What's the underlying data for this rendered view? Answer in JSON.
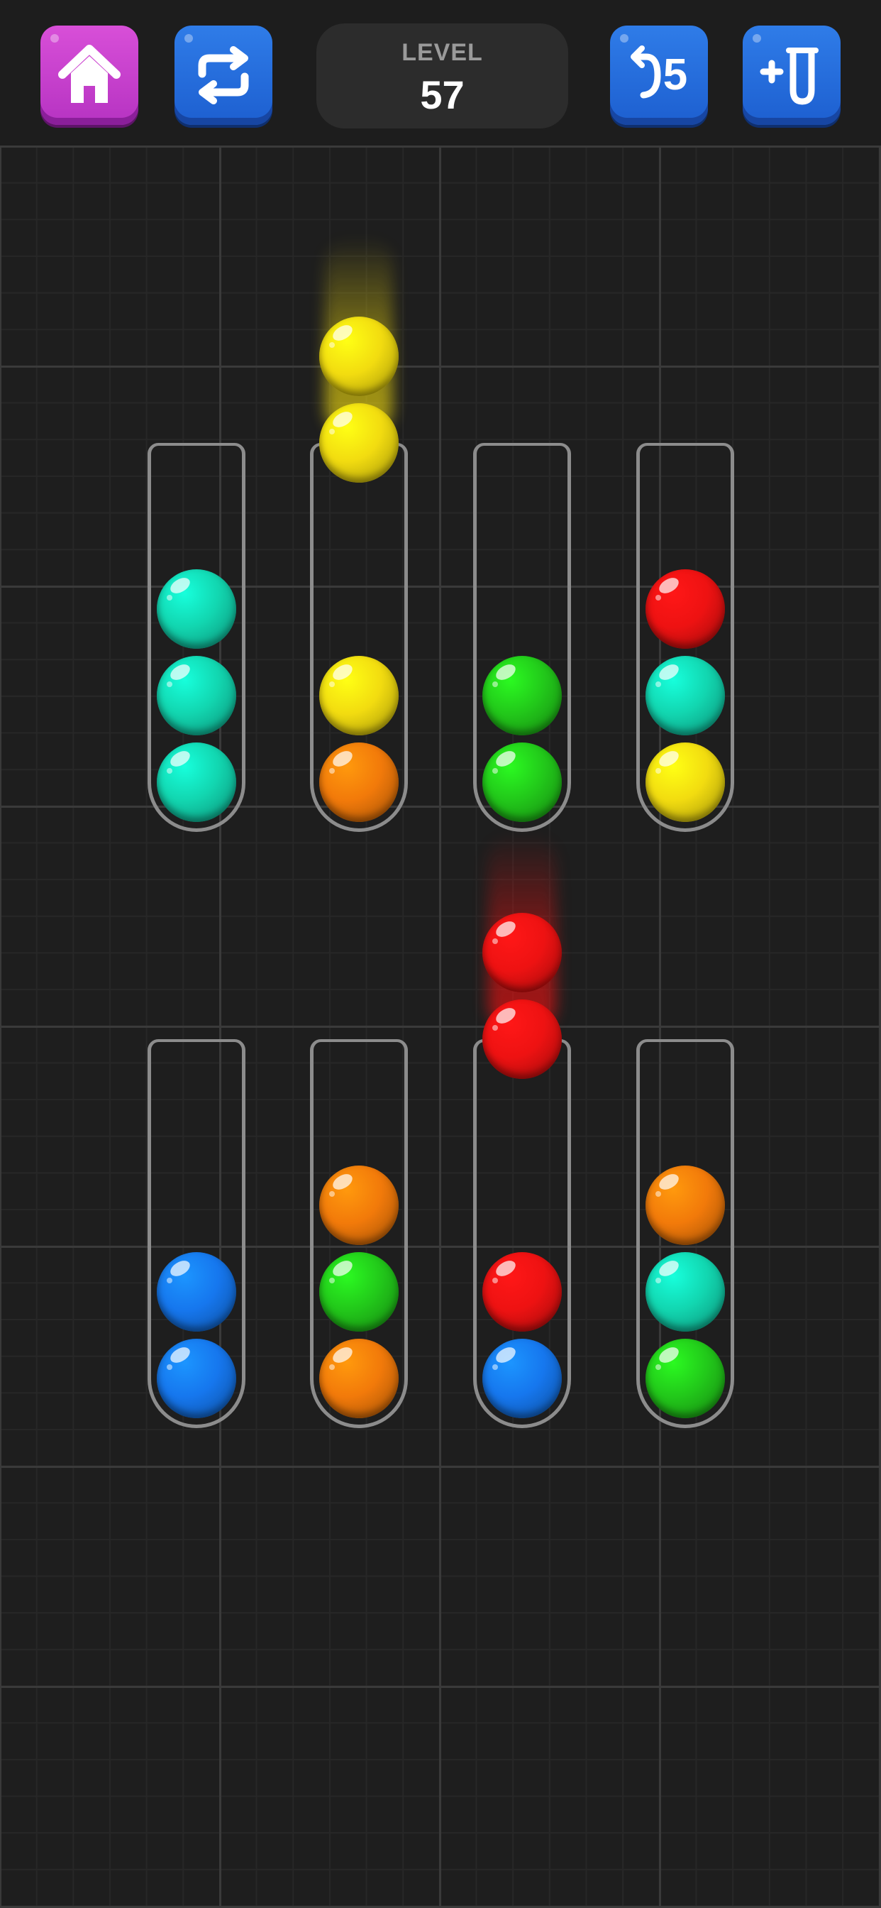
{
  "header": {
    "level_label": "LEVEL",
    "level_number": "57",
    "undo_count": "5",
    "buttons": {
      "home": {
        "icon": "home-icon",
        "color": "#c13fcc"
      },
      "restart": {
        "icon": "restart-icon",
        "color": "#2563d9"
      },
      "undo": {
        "icon": "undo-icon",
        "color": "#2563d9"
      },
      "add_tube": {
        "icon": "add-tube-icon",
        "color": "#2563d9"
      }
    }
  },
  "colors": {
    "teal": "#12d6b0",
    "yellow": "#f2dc10",
    "orange": "#f27a0a",
    "green": "#22c81a",
    "red": "#ee1212",
    "blue": "#1677ee"
  },
  "tubes": [
    {
      "row": 1,
      "lifted": [],
      "balls": [
        "teal",
        "teal",
        "teal"
      ]
    },
    {
      "row": 1,
      "lifted": [
        "yellow",
        "yellow"
      ],
      "balls": [
        "orange",
        "yellow"
      ]
    },
    {
      "row": 1,
      "lifted": [],
      "balls": [
        "green",
        "green"
      ]
    },
    {
      "row": 1,
      "lifted": [],
      "balls": [
        "yellow",
        "teal",
        "red"
      ]
    },
    {
      "row": 2,
      "lifted": [],
      "balls": [
        "blue",
        "blue"
      ]
    },
    {
      "row": 2,
      "lifted": [],
      "balls": [
        "orange",
        "green",
        "orange"
      ]
    },
    {
      "row": 2,
      "lifted": [
        "red",
        "red"
      ],
      "balls": [
        "blue",
        "red"
      ]
    },
    {
      "row": 2,
      "lifted": [],
      "balls": [
        "green",
        "teal",
        "orange"
      ]
    }
  ]
}
